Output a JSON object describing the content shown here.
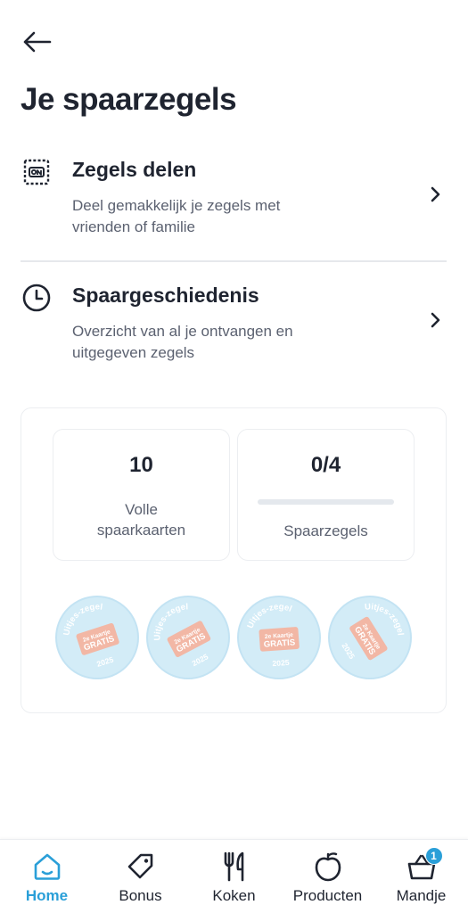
{
  "header": {
    "back_icon": "arrow-left-icon",
    "title": "Je spaarzegels"
  },
  "menu": [
    {
      "icon": "share-stamp-icon",
      "title": "Zegels delen",
      "description": "Deel gemakkelijk je zegels met vrienden of familie",
      "chevron": "chevron-right-icon"
    },
    {
      "icon": "clock-icon",
      "title": "Spaargeschiedenis",
      "description": "Overzicht van al je ontvangen en uitgegeven zegels",
      "chevron": "chevron-right-icon"
    }
  ],
  "summary": {
    "full_cards": {
      "value": "10",
      "label": "Volle spaarkaarten"
    },
    "stamps": {
      "value": "0/4",
      "label": "Spaarzegels",
      "progress": 0
    }
  },
  "stamp_slots": [
    {
      "top_text": "Uitjes-zegel",
      "ticket_line_1": "2e Kaartje",
      "ticket_line_2": "GRATIS",
      "year": "2025"
    },
    {
      "top_text": "Uitjes-zegel",
      "ticket_line_1": "2e Kaartje",
      "ticket_line_2": "GRATIS",
      "year": "2025"
    },
    {
      "top_text": "Uitjes-zegel",
      "ticket_line_1": "2e Kaartje",
      "ticket_line_2": "GRATIS",
      "year": "2025"
    },
    {
      "top_text": "Uitjes-zegel",
      "ticket_line_1": "2e Kaartje",
      "ticket_line_2": "GRATIS",
      "year": "2025"
    }
  ],
  "tabbar": {
    "active_color": "#2a9fd8",
    "tabs": [
      {
        "label": "Home",
        "icon": "home-icon",
        "active": true
      },
      {
        "label": "Bonus",
        "icon": "bonus-tag-icon",
        "active": false
      },
      {
        "label": "Koken",
        "icon": "fork-knife-icon",
        "active": false
      },
      {
        "label": "Producten",
        "icon": "apple-icon",
        "active": false
      },
      {
        "label": "Mandje",
        "icon": "basket-icon",
        "active": false,
        "badge": "1"
      }
    ]
  }
}
